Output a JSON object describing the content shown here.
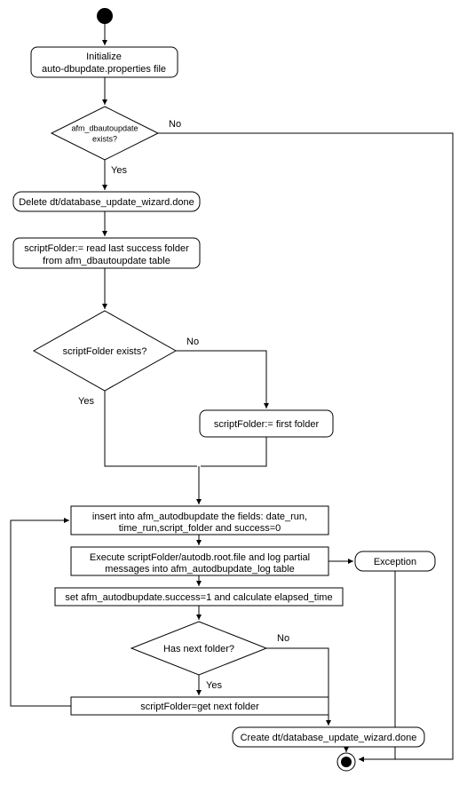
{
  "chart_data": {
    "type": "flowchart",
    "title": "",
    "nodes": [
      {
        "id": "start",
        "kind": "start",
        "label": ""
      },
      {
        "id": "init",
        "kind": "process_rounded",
        "label": [
          "Initialize",
          "auto-dbupdate.properties file"
        ]
      },
      {
        "id": "d1",
        "kind": "decision",
        "label": [
          "afm_dbautoupdate",
          "exists?"
        ]
      },
      {
        "id": "delete",
        "kind": "process_rounded",
        "label": [
          "Delete dt/database_update_wizard.done"
        ]
      },
      {
        "id": "readLast",
        "kind": "process_rounded",
        "label": [
          "scriptFolder:= read last success folder",
          "from afm_dbautoupdate table"
        ]
      },
      {
        "id": "d2",
        "kind": "decision",
        "label": [
          "scriptFolder exists?"
        ]
      },
      {
        "id": "firstFolder",
        "kind": "process_rounded",
        "label": [
          "scriptFolder:= first folder"
        ]
      },
      {
        "id": "insert",
        "kind": "process_square",
        "label": [
          "insert into afm_autodbupdate the fields: date_run,",
          "time_run,script_folder and success=0"
        ]
      },
      {
        "id": "execute",
        "kind": "process_square",
        "label": [
          "Execute scriptFolder/autodb.root.file and log partial",
          "messages into afm_autodbupdate_log table"
        ]
      },
      {
        "id": "exception",
        "kind": "process_rounded",
        "label": [
          "Exception"
        ]
      },
      {
        "id": "setSuccess",
        "kind": "process_square",
        "label": [
          "set afm_autodbupdate.success=1 and calculate elapsed_time"
        ]
      },
      {
        "id": "d3",
        "kind": "decision",
        "label": [
          "Has next folder?"
        ]
      },
      {
        "id": "getNext",
        "kind": "process_square",
        "label": [
          "scriptFolder=get next folder"
        ]
      },
      {
        "id": "create",
        "kind": "process_rounded",
        "label": [
          "Create dt/database_update_wizard.done"
        ]
      },
      {
        "id": "end",
        "kind": "end",
        "label": ""
      }
    ],
    "edges": [
      {
        "from": "start",
        "to": "init",
        "label": ""
      },
      {
        "from": "init",
        "to": "d1",
        "label": ""
      },
      {
        "from": "d1",
        "to": "delete",
        "label": "Yes"
      },
      {
        "from": "d1",
        "to": "end",
        "label": "No"
      },
      {
        "from": "delete",
        "to": "readLast",
        "label": ""
      },
      {
        "from": "readLast",
        "to": "d2",
        "label": ""
      },
      {
        "from": "d2",
        "to": "merge",
        "label": "Yes"
      },
      {
        "from": "d2",
        "to": "firstFolder",
        "label": "No"
      },
      {
        "from": "firstFolder",
        "to": "merge",
        "label": ""
      },
      {
        "from": "merge",
        "to": "insert",
        "label": ""
      },
      {
        "from": "insert",
        "to": "execute",
        "label": ""
      },
      {
        "from": "execute",
        "to": "exception",
        "label": ""
      },
      {
        "from": "execute",
        "to": "setSuccess",
        "label": ""
      },
      {
        "from": "setSuccess",
        "to": "d3",
        "label": ""
      },
      {
        "from": "d3",
        "to": "getNext",
        "label": "Yes"
      },
      {
        "from": "d3",
        "to": "create",
        "label": "No"
      },
      {
        "from": "getNext",
        "to": "insert",
        "label": ""
      },
      {
        "from": "create",
        "to": "end",
        "label": ""
      },
      {
        "from": "exception",
        "to": "end",
        "label": ""
      }
    ]
  },
  "labels": {
    "yes": "Yes",
    "no": "No"
  }
}
